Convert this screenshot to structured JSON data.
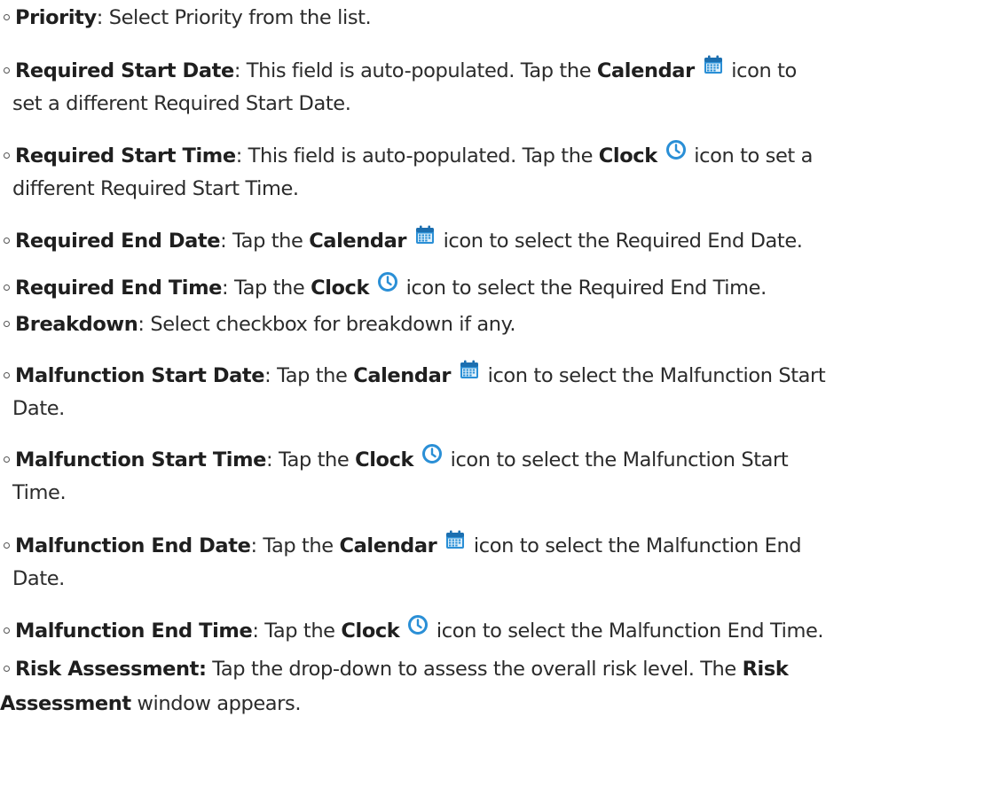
{
  "icons": {
    "calendar": "calendar-icon",
    "clock": "clock-icon"
  },
  "colors": {
    "text": "#2b2b2b",
    "icon_blue": "#2a8fd6"
  },
  "items": {
    "priority": {
      "label": "Priority",
      "desc": ": Select Priority from the list."
    },
    "req_start_date": {
      "label": "Required Start Date",
      "t1": ": This field is auto-populated. Tap the ",
      "icon_label": "Calendar",
      "t2": " icon to",
      "t3": "set a different Required Start Date."
    },
    "req_start_time": {
      "label": "Required Start Time",
      "t1": ": This field is auto-populated. Tap the ",
      "icon_label": "Clock",
      "t2": " icon to set a",
      "t3": "different Required Start Time."
    },
    "req_end_date": {
      "label": "Required End Date",
      "t1": ": Tap the ",
      "icon_label": "Calendar",
      "t2": " icon to select the Required End Date."
    },
    "req_end_time": {
      "label": "Required End Time",
      "t1": ": Tap the ",
      "icon_label": "Clock",
      "t2": " icon to select the Required End Time."
    },
    "breakdown": {
      "label": "Breakdown",
      "desc": ": Select checkbox for breakdown if any."
    },
    "mal_start_date": {
      "label": "Malfunction Start Date",
      "t1": ": Tap the ",
      "icon_label": "Calendar",
      "t2": " icon to select the Malfunction Start",
      "t3": "Date."
    },
    "mal_start_time": {
      "label": "Malfunction Start Time",
      "t1": ": Tap the ",
      "icon_label": "Clock",
      "t2": " icon to select the Malfunction Start",
      "t3": "Time."
    },
    "mal_end_date": {
      "label": "Malfunction End Date",
      "t1": ": Tap the ",
      "icon_label": "Calendar",
      "t2": " icon to select the Malfunction End",
      "t3": "Date."
    },
    "mal_end_time": {
      "label": "Malfunction End Time",
      "t1": ": Tap the ",
      "icon_label": "Clock",
      "t2": " icon to select the Malfunction End Time."
    },
    "risk": {
      "label": "Risk Assessment:",
      "t1": " Tap the drop-down to assess the overall risk level. The ",
      "bold2": "Risk",
      "bold3": "Assessment",
      "t3": " window appears."
    }
  }
}
